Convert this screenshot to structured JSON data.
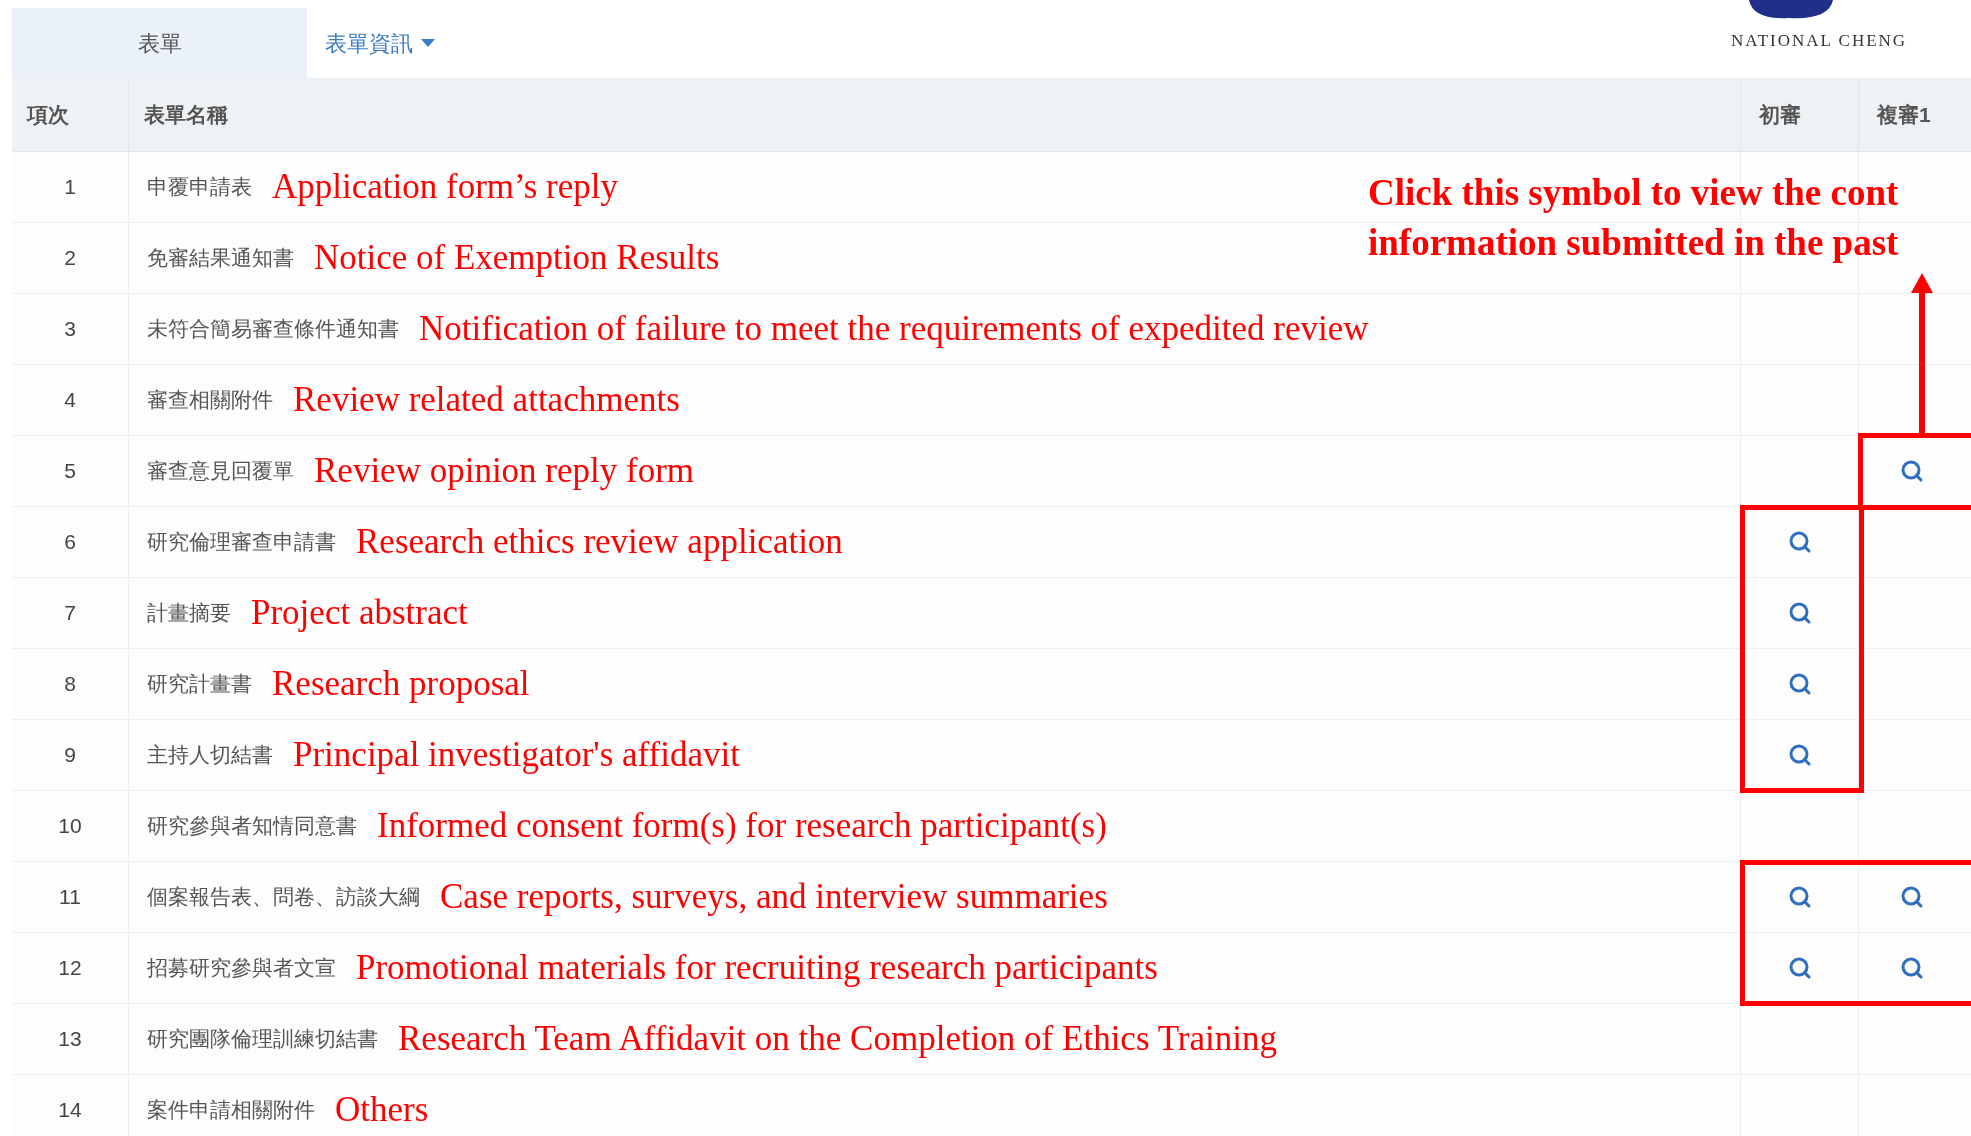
{
  "tabs": [
    {
      "label": "表單",
      "selected": true,
      "dropdown": false
    },
    {
      "label": "表單資訊",
      "selected": false,
      "dropdown": true
    }
  ],
  "logo": {
    "text": "NATIONAL CHENG"
  },
  "table": {
    "columns": [
      "項次",
      "表單名稱",
      "初審",
      "複審1"
    ],
    "rows": [
      {
        "number": "1",
        "name": "申覆申請表",
        "note": "Application form’s reply",
        "initial": false,
        "review1": false
      },
      {
        "number": "2",
        "name": "免審結果通知書",
        "note": "Notice of Exemption Results",
        "initial": false,
        "review1": false
      },
      {
        "number": "3",
        "name": "未符合簡易審查條件通知書",
        "note": "Notification of failure to meet the requirements of expedited review",
        "initial": false,
        "review1": false
      },
      {
        "number": "4",
        "name": "審查相關附件",
        "note": "Review related attachments",
        "initial": false,
        "review1": false
      },
      {
        "number": "5",
        "name": "審查意見回覆單",
        "note": "Review opinion reply form",
        "initial": false,
        "review1": true
      },
      {
        "number": "6",
        "name": "研究倫理審查申請書",
        "note": "Research ethics review application",
        "initial": true,
        "review1": false
      },
      {
        "number": "7",
        "name": "計畫摘要",
        "note": "Project abstract",
        "initial": true,
        "review1": false
      },
      {
        "number": "8",
        "name": "研究計畫書",
        "note": "Research proposal",
        "initial": true,
        "review1": false
      },
      {
        "number": "9",
        "name": "主持人切結書",
        "note": "Principal investigator's affidavit",
        "initial": true,
        "review1": false
      },
      {
        "number": "10",
        "name": "研究參與者知情同意書",
        "note": "Informed consent form(s) for research participant(s)",
        "initial": false,
        "review1": false
      },
      {
        "number": "11",
        "name": "個案報告表、問卷、訪談大綱",
        "note": "Case reports, surveys, and interview summaries",
        "initial": true,
        "review1": true
      },
      {
        "number": "12",
        "name": "招募研究參與者文宣",
        "note": "Promotional materials for recruiting research participants",
        "initial": true,
        "review1": true
      },
      {
        "number": "13",
        "name": "研究團隊倫理訓練切結書",
        "note": "Research Team Affidavit on the Completion of Ethics Training",
        "initial": false,
        "review1": false
      },
      {
        "number": "14",
        "name": "案件申請相關附件",
        "note": "Others",
        "initial": false,
        "review1": false
      }
    ]
  },
  "callout": {
    "lines": [
      "Click this symbol to view the cont",
      "information submitted in the past"
    ]
  }
}
